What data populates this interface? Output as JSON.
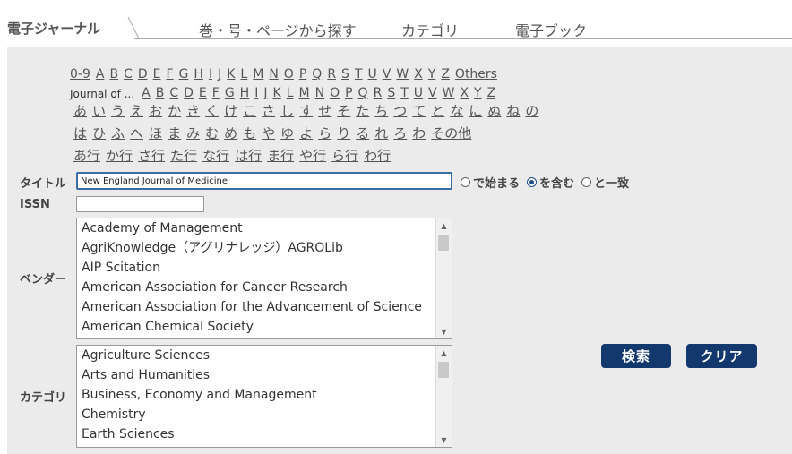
{
  "tabs": {
    "active": "電子ジャーナル",
    "items": [
      "巻・号・ページから探す",
      "カテゴリ",
      "電子ブック"
    ]
  },
  "index": {
    "latin_row1": [
      "0-9",
      "A",
      "B",
      "C",
      "D",
      "E",
      "F",
      "G",
      "H",
      "I",
      "J",
      "K",
      "L",
      "M",
      "N",
      "O",
      "P",
      "Q",
      "R",
      "S",
      "T",
      "U",
      "V",
      "W",
      "X",
      "Y",
      "Z",
      "Others"
    ],
    "latin_row2_label": "Journal of ...",
    "latin_row2": [
      "A",
      "B",
      "C",
      "D",
      "E",
      "F",
      "G",
      "H",
      "I",
      "J",
      "K",
      "L",
      "M",
      "N",
      "O",
      "P",
      "Q",
      "R",
      "S",
      "T",
      "U",
      "V",
      "W",
      "X",
      "Y",
      "Z"
    ],
    "kana_row1": [
      "あ",
      "い",
      "う",
      "え",
      "お",
      "か",
      "き",
      "く",
      "け",
      "こ",
      "さ",
      "し",
      "す",
      "せ",
      "そ",
      "た",
      "ち",
      "つ",
      "て",
      "と",
      "な",
      "に",
      "ぬ",
      "ね",
      "の"
    ],
    "kana_row2": [
      "は",
      "ひ",
      "ふ",
      "へ",
      "ほ",
      "ま",
      "み",
      "む",
      "め",
      "も",
      "や",
      "ゆ",
      "よ",
      "ら",
      "り",
      "る",
      "れ",
      "ろ",
      "わ",
      "その他"
    ],
    "kana_row3": [
      "あ行",
      "か行",
      "さ行",
      "た行",
      "な行",
      "は行",
      "ま行",
      "や行",
      "ら行",
      "わ行"
    ]
  },
  "form": {
    "title_label": "タイトル",
    "title_value": "New England Journal of Medicine",
    "issn_label": "ISSN",
    "issn_value": "",
    "match_options": [
      {
        "label": "で始まる",
        "selected": false
      },
      {
        "label": "を含む",
        "selected": true
      },
      {
        "label": "と一致",
        "selected": false
      }
    ],
    "vendor_label": "ベンダー",
    "vendors": [
      "Academy of Management",
      "AgriKnowledge（アグリナレッジ）AGROLib",
      "AIP Scitation",
      "American Association for Cancer Research",
      "American Association for the Advancement of Science",
      "American Chemical Society"
    ],
    "category_label": "カテゴリ",
    "categories": [
      "Agriculture Sciences",
      "Arts and Humanities",
      "Business, Economy and Management",
      "Chemistry",
      "Earth Sciences"
    ],
    "search_button": "検索",
    "clear_button": "クリア"
  },
  "colors": {
    "button_bg": "#13386d",
    "panel_bg": "#ebebeb",
    "radio_selected": "#1f4f8b"
  }
}
